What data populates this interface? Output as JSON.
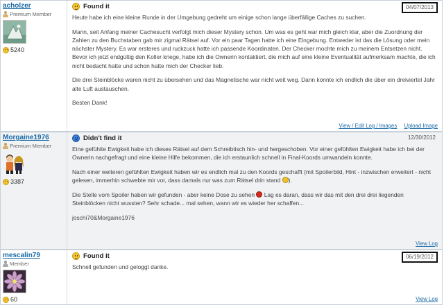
{
  "logs": [
    {
      "username": "acholzer",
      "rank": "Premium Member",
      "finds": "5240",
      "log_type": "Found it",
      "date": "04/07/2013",
      "text": [
        "Heute habe ich eine kleine Runde in der Umgebung gedreht um einige schon lange überfällige Caches zu suchen.",
        "Mann, seit Anfang meiner Cachesucht verfolgt mich dieser Mystery schon. Um was es geht war mich gleich klar, aber die Zuordnung der Zahlen zu den Buchstaben gab mir zigmal Rätsel auf. Vor ein paar Tagen hatte ich eine Eingebung. Entweder ist das die Lösung oder mein nächster Mystery. Es war ersteres und ruckzuck hatte ich passende Koordinaten. Der Checker mochte mich zu meinem Entsetzen nicht. Bevor ich jetzt endgültig den Koller kriege, habe ich die Ownerin kontaktiert, die mich auf eine kleine Eventualität aufmerksam machte, die ich nicht bedacht hatte und schon hatte mich der Checker lieb.",
        "Die drei Steinblöcke waren nicht zu übersehen und das Magnetische war nicht weit weg. Dann konnte ich endlich die über ein dreiviertel Jahr alte Luft austauschen.",
        "Besten Dank!"
      ],
      "actions": [
        "View / Edit Log / Images",
        "Upload Image"
      ]
    },
    {
      "username": "Morgaine1976",
      "rank": "Premium Member",
      "finds": "3387",
      "log_type": "Didn't find it",
      "date": "12/30/2012",
      "text_p1": "Eine gefühlte Ewigkeit habe ich dieses Rätsel auf dem Schreibtisch hin- und hergeschoben. Vor einer gefühlten Ewigkeit habe ich bei der Ownerin nachgefragt und eine kleine Hilfe bekommen, die ich erstaunlich schnell in Final-Koords umwandeln konnte.",
      "text_p2": "Nach einer weiteren gefühlten Ewigkeit haben wir es endlich mal zu den Koords geschafft (mit Spoilerbild, Hint - inzwischen erweitert - nicht gelesen, immerhin schwebte mir vor, dass damals nur was zum Rätsel drin stand",
      "text_p2_end": ").",
      "text_p3_a": "Die Stelle vom Spoiler haben wir gefunden - aber keine Dose zu sehen",
      "text_p3_b": "Lag es daran, dass wir das mit den drei drei liegenden Steinblöcken nicht wussten? Sehr schade... mal sehen, wann wir es wieder her schaffen...",
      "text_p4": "joschi70&Morgaine1976",
      "action": "View Log"
    },
    {
      "username": "mescalin79",
      "rank": "Member",
      "finds": "60",
      "log_type": "Found it",
      "date": "06/19/2012",
      "text": "Schnell gefunden und geloggt danke.",
      "action": "View Log"
    }
  ]
}
